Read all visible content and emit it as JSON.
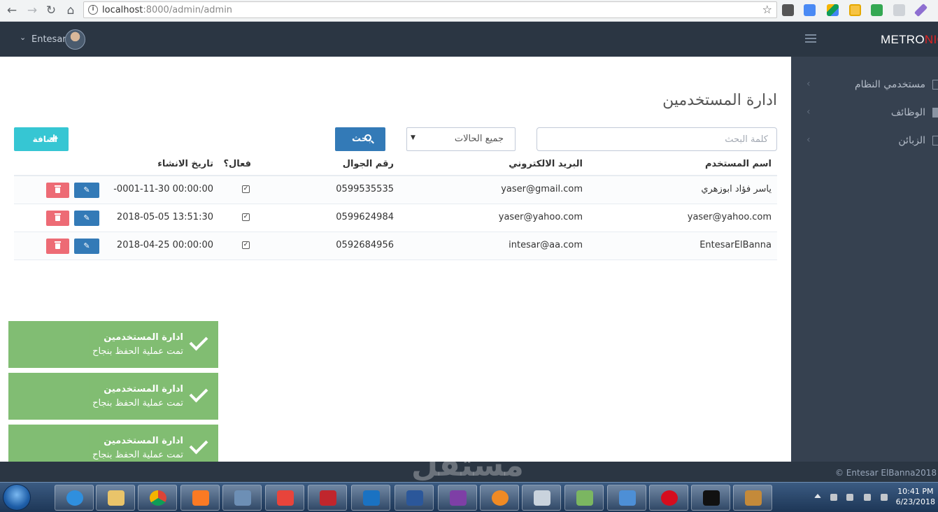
{
  "browser": {
    "url_host": "localhost",
    "url_path": ":8000/admin/admin"
  },
  "header": {
    "user_name": "Entesar",
    "logo_main": "METRO",
    "logo_accent": "NIC"
  },
  "sidebar": {
    "items": [
      {
        "label": "مستخدمي النظام"
      },
      {
        "label": "الوظائف"
      },
      {
        "label": "الزبائن"
      }
    ]
  },
  "page": {
    "title": "ادارة المستخدمين"
  },
  "filters": {
    "search_placeholder": "كلمة البحث",
    "status_value": "جميع الحالات",
    "search_button": "بحث",
    "add_button": "اضافة"
  },
  "table": {
    "headers": {
      "name": "اسم المستخدم",
      "email": "البريد الالكتروني",
      "phone": "رقم الجوال",
      "active": "فعال؟",
      "created": "تاريخ الانشاء"
    },
    "rows": [
      {
        "name": "ياسر فؤاد ابوزهري",
        "email": "yaser@gmail.com",
        "phone": "0599535535",
        "active": true,
        "created": "-0001-11-30 00:00:00"
      },
      {
        "name": "yaser@yahoo.com",
        "email": "yaser@yahoo.com",
        "phone": "0599624984",
        "active": true,
        "created": "2018-05-05 13:51:30"
      },
      {
        "name": "EntesarElBanna",
        "email": "intesar@aa.com",
        "phone": "0592684956",
        "active": true,
        "created": "2018-04-25 00:00:00"
      }
    ]
  },
  "toasts": [
    {
      "title": "ادارة المستخدمين",
      "message": "تمت عملية الحفظ بنجاح"
    },
    {
      "title": "ادارة المستخدمين",
      "message": "تمت عملية الحفظ بنجاح"
    },
    {
      "title": "ادارة المستخدمين",
      "message": "تمت عملية الحفظ بنجاح"
    }
  ],
  "footer": {
    "copyright": "© Entesar ElBanna2018"
  },
  "watermark": "مستقل",
  "taskbar": {
    "time": "10:41 PM",
    "date": "6/23/2018"
  },
  "colors": {
    "header_bg": "#2b3643",
    "sidebar_bg": "#364150",
    "primary": "#337ab7",
    "add": "#36c6d3",
    "danger": "#ed6b75",
    "toast": "#7dbb6e",
    "logo_accent": "#e02222"
  }
}
